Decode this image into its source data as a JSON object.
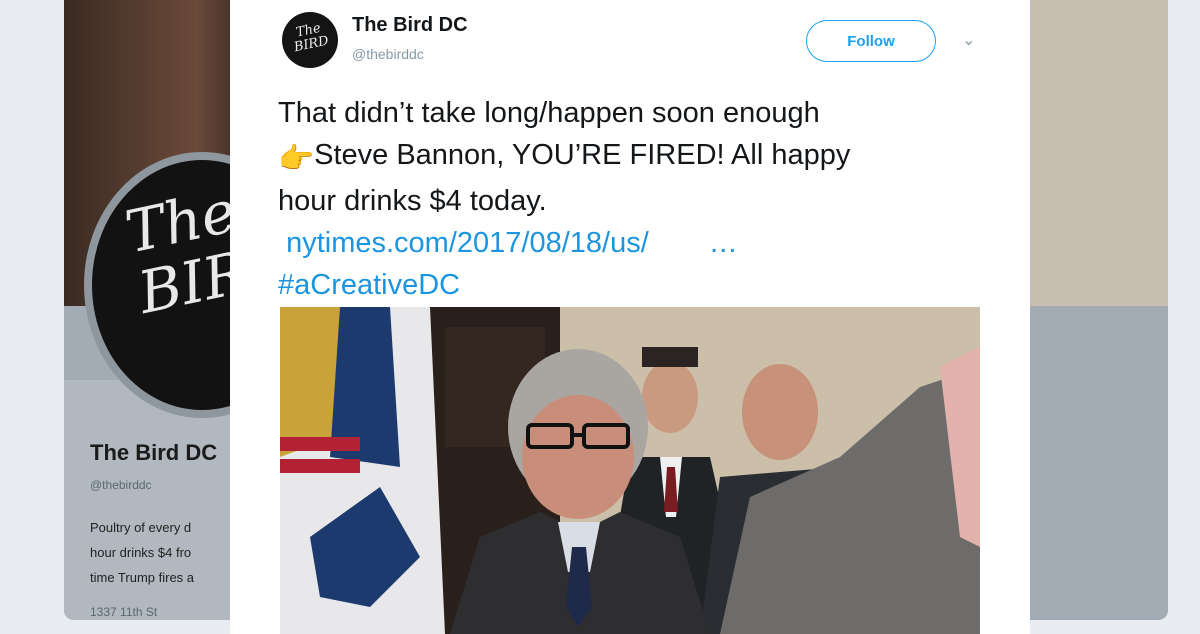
{
  "background_profile": {
    "avatar_text": [
      "The",
      "BIR"
    ],
    "name": "The Bird DC",
    "handle": "@thebirddc",
    "bio_lines": [
      "Poultry of every d",
      "hour drinks $4 fro",
      "time Trump fires a"
    ],
    "location": "1337 11th St"
  },
  "tweet": {
    "avatar_text": "The BIRD",
    "display_name": "The Bird DC",
    "handle": "@thebirddc",
    "follow_label": "Follow",
    "caret": "⌄",
    "text_line1": "That didn’t take long/happen soon enough",
    "emoji": "👉",
    "text_line2": "Steve Bannon, YOU’RE FIRED! All happy",
    "text_line3": "hour drinks $4 today.",
    "link": "nytimes.com/2017/08/18/us/",
    "link_ellipsis": "…",
    "hashtag": "#aCreativeDC"
  },
  "colors": {
    "link": "#1b95e0",
    "follow": "#1da1f2",
    "text": "#14171a",
    "muted": "#8899a6"
  }
}
